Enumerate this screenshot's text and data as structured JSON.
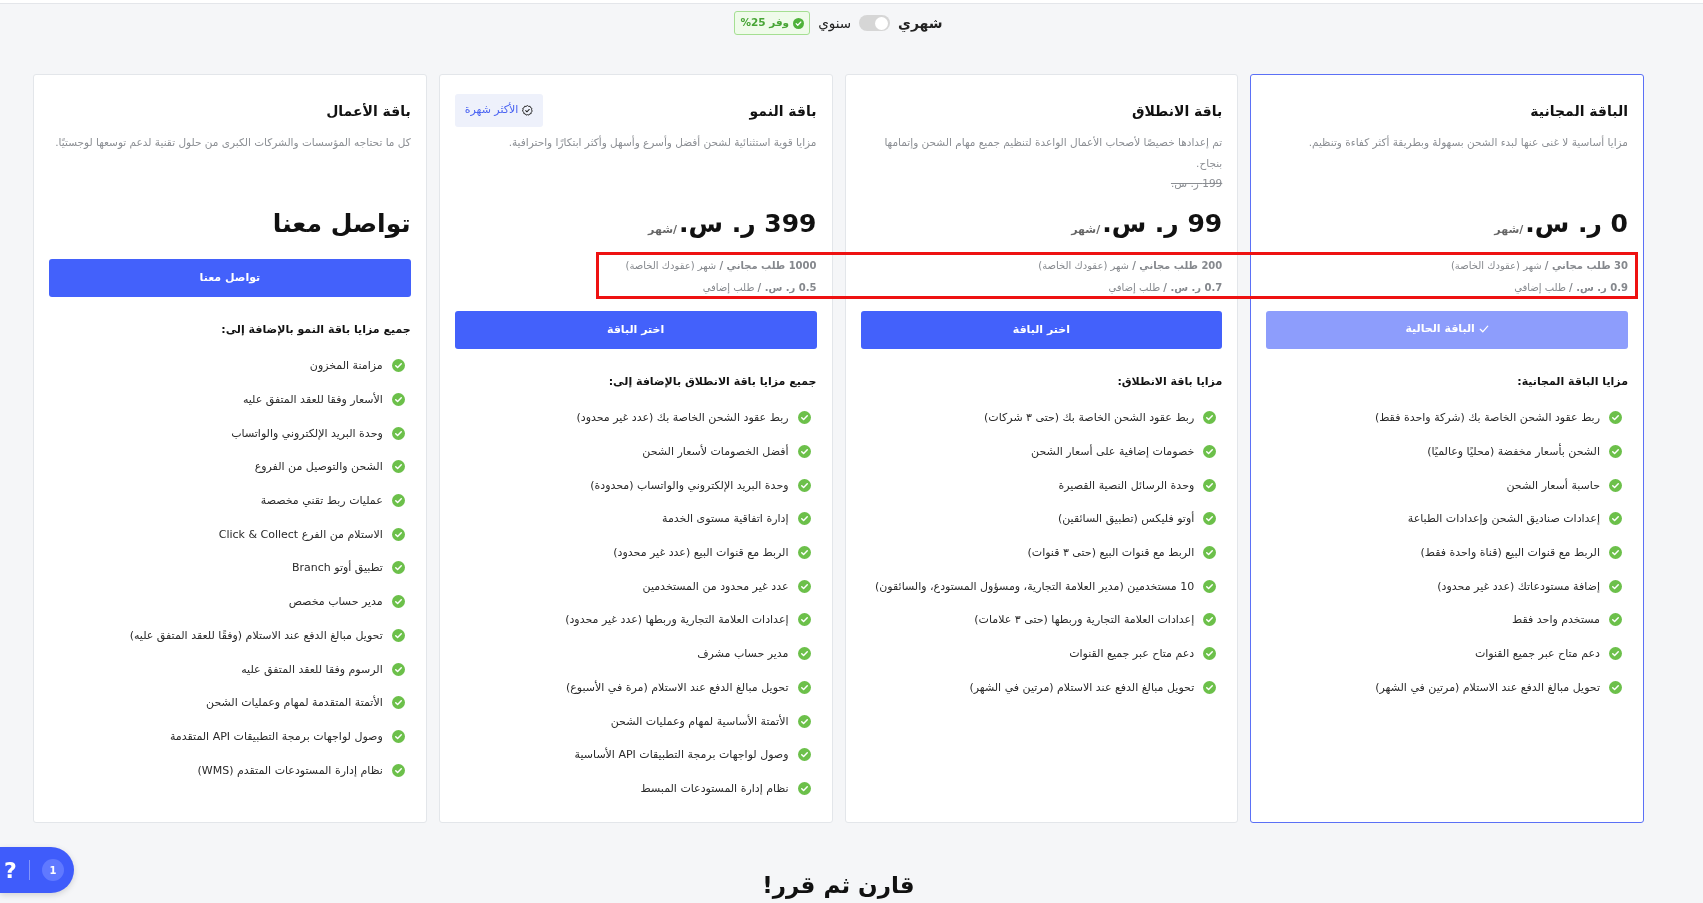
{
  "billing": {
    "options": [
      {
        "label": "شهري",
        "selected": true
      },
      {
        "label": "سنوي",
        "selected": false
      }
    ],
    "discount_badge": "وفر 25%"
  },
  "plans": [
    {
      "name": "الباقة المجانية",
      "description": "مزايا أساسية لا غنى عنها لبدء الشحن بسهولة وبطريقة أكثر كفاءة وتنظيم.",
      "price": "0 ر. س.",
      "period": "/شهر",
      "quota": {
        "highlighted": true,
        "lines": [
          "**30 طلب مجاني /** شهر (عقودك الخاصة)",
          "**0.9 ر. س. /** طلب إضافي"
        ]
      },
      "current": true,
      "button": "الباقة الحالية",
      "features_title": "مزايا الباقة المجانية:",
      "features": [
        "ربط عقود الشحن الخاصة بك (شركة واحدة فقط)",
        "الشحن بأسعار مخفضة (محليًا وعالميًا)",
        "حاسبة أسعار الشحن",
        "إعدادات صناديق الشحن وإعدادات الطباعة",
        "الربط مع قنوات البيع (قناة واحدة فقط)",
        "إضافة مستودعاتك (عدد غير محدود)",
        "مستخدم واحد فقط",
        "دعم متاح عبر جميع القنوات",
        "تحويل مبالغ الدفع عند الاستلام (مرتين في الشهر)"
      ]
    },
    {
      "name": "باقة الانطلاق",
      "description": "تم إعدادها خصيصًا لأصحاب الأعمال الواعدة لتنظيم جميع مهام الشحن وإتمامها بنجاح.",
      "old_price": "199 ر. س.",
      "price": "99 ر. س.",
      "period": "/شهر",
      "quota": {
        "highlighted": true,
        "lines": [
          "**200 طلب مجاني /** شهر (عقودك الخاصة)",
          "**0.7 ر. س. /** طلب إضافي"
        ]
      },
      "current": false,
      "button": "اختر الباقة",
      "features_title": "مزايا باقة الانطلاق:",
      "features": [
        "ربط عقود الشحن الخاصة بك (حتى ٣ شركات)",
        "خصومات إضافية على أسعار الشحن",
        "وحدة الرسائل النصية القصيرة",
        "أوتو فليكس (تطبيق السائقين)",
        "الربط مع قنوات البيع (حتى ٣ قنوات)",
        "10 مستخدمين (مدير العلامة التجارية، ومسؤول المستودع، والسائقون)",
        "إعدادات العلامة التجارية وربطها (حتى ٣ علامات)",
        "دعم متاح عبر جميع القنوات",
        "تحويل مبالغ الدفع عند الاستلام (مرتين في الشهر)"
      ]
    },
    {
      "name": "باقة النمو",
      "badge": "الأكثر شهرة",
      "description": "مزايا قوية استثنائية لشحن أفضل وأسرع وأسهل وأكثر ابتكارًا واحترافية.",
      "price": "399 ر. س.",
      "period": "/شهر",
      "quota": {
        "highlighted": true,
        "lines": [
          "**1000 طلب مجاني /** شهر (عقودك الخاصة)",
          "**0.5 ر. س. /** طلب إضافي"
        ]
      },
      "current": false,
      "button": "اختر الباقة",
      "features_title": "جميع مزايا باقة الانطلاق بالإضافة إلى:",
      "features": [
        "ربط عقود الشحن الخاصة بك (عدد غير محدود)",
        "أفضل الخصومات لأسعار الشحن",
        "وحدة البريد الإلكتروني والواتساب (محدودة)",
        "إدارة اتفاقية مستوى الخدمة",
        "الربط مع قنوات البيع (عدد غير محدود)",
        "عدد غير محدود من المستخدمين",
        "إعدادات العلامة التجارية وربطها (عدد غير محدود)",
        "مدير حساب مشرف",
        "تحويل مبالغ الدفع عند الاستلام (مرة في الأسبوع)",
        "الأتمتة الأساسية لمهام وعمليات الشحن",
        "وصول لواجهات برمجة التطبيقات API الأساسية",
        "نظام إدارة المستودعات المبسط"
      ]
    },
    {
      "name": "باقة الأعمال",
      "description": "كل ما تحتاجه المؤسسات والشركات الكبرى من حلول تقنية لدعم توسعها لوجستيًا.",
      "price": "تواصل معنا",
      "current": false,
      "button": "تواصل معنا",
      "features_title": "جميع مزايا باقة النمو بالإضافة إلى:",
      "features": [
        "مزامنة المخزون",
        "الأسعار وفقا للعقد المتفق عليه",
        "وحدة البريد الإلكتروني والواتساب",
        "الشحن والتوصيل من الفروع",
        "عمليات ربط تقني مخصصة",
        "الاستلام من الفرع Click & Collect",
        "تطبيق أوتو Branch",
        "مدير حساب مخصص",
        "تحويل مبالغ الدفع عند الاستلام (وفقًا للعقد المتفق عليه)",
        "الرسوم وفقا للعقد المتفق عليه",
        "الأتمتة المتقدمة لمهام وعمليات الشحن",
        "وصول لواجهات برمجة التطبيقات API المتقدمة",
        "نظام إدارة المستودعات المتقدم (WMS)"
      ]
    }
  ],
  "compare_heading": "قارن ثم قرر!",
  "help_widget": {
    "label": "?",
    "count": "1"
  }
}
